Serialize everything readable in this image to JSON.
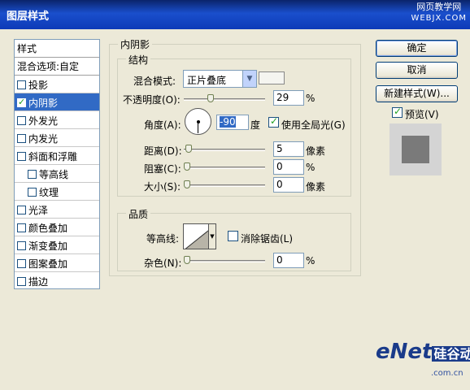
{
  "window": {
    "title": "图层样式",
    "watermark_top_line1": "网页教学网",
    "watermark_top_line2": "WEBJX.COM"
  },
  "style_list": {
    "header": "样式",
    "blend_options": "混合选项:自定",
    "items": [
      {
        "label": "投影",
        "checked": false,
        "selected": false
      },
      {
        "label": "内阴影",
        "checked": true,
        "selected": true
      },
      {
        "label": "外发光",
        "checked": false,
        "selected": false
      },
      {
        "label": "内发光",
        "checked": false,
        "selected": false
      },
      {
        "label": "斜面和浮雕",
        "checked": false,
        "selected": false
      },
      {
        "label": "等高线",
        "checked": false,
        "selected": false,
        "indent": true
      },
      {
        "label": "纹理",
        "checked": false,
        "selected": false,
        "indent": true
      },
      {
        "label": "光泽",
        "checked": false,
        "selected": false
      },
      {
        "label": "颜色叠加",
        "checked": false,
        "selected": false
      },
      {
        "label": "渐变叠加",
        "checked": false,
        "selected": false
      },
      {
        "label": "图案叠加",
        "checked": false,
        "selected": false
      },
      {
        "label": "描边",
        "checked": false,
        "selected": false
      }
    ]
  },
  "inner_shadow": {
    "section_title": "内阴影",
    "structure": {
      "title": "结构",
      "blend_mode_label": "混合模式:",
      "blend_mode_value": "正片叠底",
      "opacity_label": "不透明度(O):",
      "opacity_value": "29",
      "opacity_unit": "%",
      "opacity_fraction": 0.29,
      "angle_label": "角度(A):",
      "angle_value": "-90",
      "angle_unit": "度",
      "global_light_label": "使用全局光(G)",
      "global_light_checked": true,
      "distance_label": "距离(D):",
      "distance_value": "5",
      "distance_unit": "像素",
      "distance_fraction": 0.02,
      "choke_label": "阻塞(C):",
      "choke_value": "0",
      "choke_unit": "%",
      "choke_fraction": 0,
      "size_label": "大小(S):",
      "size_value": "0",
      "size_unit": "像素",
      "size_fraction": 0
    },
    "quality": {
      "title": "品质",
      "contour_label": "等高线:",
      "anti_alias_label": "消除锯齿(L)",
      "anti_alias_checked": false,
      "noise_label": "杂色(N):",
      "noise_value": "0",
      "noise_unit": "%",
      "noise_fraction": 0
    }
  },
  "buttons": {
    "ok": "确定",
    "cancel": "取消",
    "new_style": "新建样式(W)...",
    "preview_label": "预览(V)",
    "preview_checked": true
  },
  "watermark_bottom": {
    "brand": "eNet",
    "brand_cn": "硅谷动力",
    "domain": ".com.cn"
  },
  "colors": {
    "selection": "#316ac5",
    "dialog_bg": "#ece9d8",
    "titlebar": "#0a246a",
    "shadow_color": "#f5f5f0",
    "preview_fill": "#7a7a7a"
  }
}
